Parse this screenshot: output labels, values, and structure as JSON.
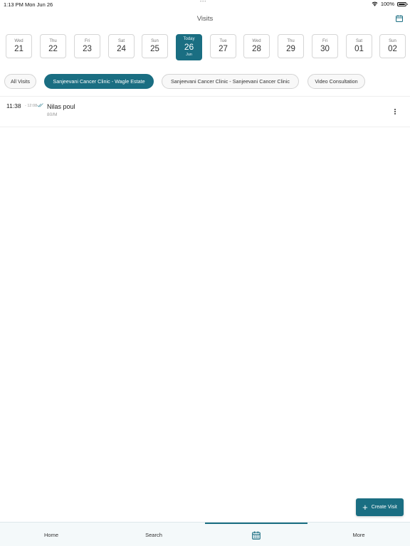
{
  "status_bar": {
    "time": "1:13 PM",
    "date": "Mon Jun 26",
    "battery": "100%",
    "battery_level": 1.0,
    "wifi_icon": "wifi-icon"
  },
  "header": {
    "title": "Visits",
    "calendar_icon": "calendar-icon"
  },
  "date_strip": [
    {
      "dow": "Wed",
      "day": "21"
    },
    {
      "dow": "Thu",
      "day": "22"
    },
    {
      "dow": "Fri",
      "day": "23"
    },
    {
      "dow": "Sat",
      "day": "24"
    },
    {
      "dow": "Sun",
      "day": "25"
    },
    {
      "dow": "Today",
      "day": "26",
      "month": "Jun",
      "selected": true
    },
    {
      "dow": "Tue",
      "day": "27"
    },
    {
      "dow": "Wed",
      "day": "28"
    },
    {
      "dow": "Thu",
      "day": "29"
    },
    {
      "dow": "Fri",
      "day": "30"
    },
    {
      "dow": "Sat",
      "day": "01"
    },
    {
      "dow": "Sun",
      "day": "02"
    }
  ],
  "filters": [
    {
      "label": "All Visits"
    },
    {
      "label": "Sanjeevani Cancer Clinic - Wagle Estate",
      "selected": true
    },
    {
      "label": "Sanjeevani Cancer Clinic - Sanjeevani Cancer Clinic"
    },
    {
      "label": "Video Consultation"
    }
  ],
  "visits": [
    {
      "start": "11:38",
      "end": "- 12:08",
      "status_icon": "double-check-icon",
      "patient": "Nilas poul",
      "meta": "80/M"
    }
  ],
  "create_visit": {
    "label": "Create Visit",
    "icon": "plus-icon"
  },
  "tab_bar": [
    {
      "label": "Home"
    },
    {
      "label": "Search"
    },
    {
      "label": "",
      "icon": "calendar-grid-icon",
      "selected": true
    },
    {
      "label": "More"
    }
  ],
  "colors": {
    "accent": "#1a6e82",
    "background": "#ffffff",
    "tab_bar_bg": "#f4f9fa"
  }
}
